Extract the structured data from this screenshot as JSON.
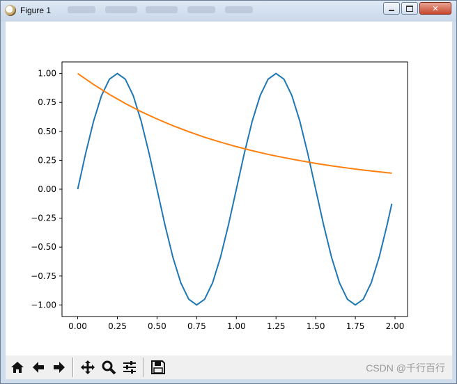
{
  "window": {
    "title": "Figure 1",
    "buttons": {
      "minimize": "minimize",
      "maximize": "maximize",
      "close": "close"
    }
  },
  "toolbar": {
    "items": [
      {
        "name": "home",
        "icon": "home-icon"
      },
      {
        "name": "back",
        "icon": "arrow-left-icon"
      },
      {
        "name": "forward",
        "icon": "arrow-right-icon"
      },
      {
        "name": "pan",
        "icon": "move-icon"
      },
      {
        "name": "zoom",
        "icon": "magnifier-icon"
      },
      {
        "name": "configure-subplots",
        "icon": "sliders-icon"
      },
      {
        "name": "save",
        "icon": "floppy-disk-icon"
      }
    ]
  },
  "watermark": "CSDN @千行百行",
  "chart_data": {
    "type": "line",
    "title": "",
    "xlabel": "",
    "ylabel": "",
    "xlim": [
      -0.099,
      2.079
    ],
    "ylim": [
      -1.1,
      1.1
    ],
    "grid": false,
    "x_ticks": [
      "0.00",
      "0.25",
      "0.50",
      "0.75",
      "1.00",
      "1.25",
      "1.50",
      "1.75",
      "2.00"
    ],
    "x_tick_values": [
      0,
      0.25,
      0.5,
      0.75,
      1.0,
      1.25,
      1.5,
      1.75,
      2.0
    ],
    "y_ticks": [
      "−1.00",
      "−0.75",
      "−0.50",
      "−0.25",
      "0.00",
      "0.25",
      "0.50",
      "0.75",
      "1.00"
    ],
    "y_tick_values": [
      -1,
      -0.75,
      -0.5,
      -0.25,
      0,
      0.25,
      0.5,
      0.75,
      1
    ],
    "series": [
      {
        "color": "#1f77b4",
        "x": [
          0.0,
          0.05,
          0.1,
          0.15,
          0.2,
          0.25,
          0.3,
          0.35,
          0.4,
          0.45,
          0.5,
          0.55,
          0.6,
          0.65,
          0.7,
          0.75,
          0.8,
          0.85,
          0.9,
          0.95,
          1.0,
          1.05,
          1.1,
          1.15,
          1.2,
          1.25,
          1.3,
          1.35,
          1.4,
          1.45,
          1.5,
          1.55,
          1.6,
          1.65,
          1.7,
          1.75,
          1.8,
          1.85,
          1.9,
          1.95,
          1.98
        ],
        "y": [
          0.0,
          0.309,
          0.588,
          0.809,
          0.951,
          1.0,
          0.951,
          0.809,
          0.588,
          0.309,
          0.0,
          -0.309,
          -0.588,
          -0.809,
          -0.951,
          -1.0,
          -0.951,
          -0.809,
          -0.588,
          -0.309,
          0.0,
          0.309,
          0.588,
          0.809,
          0.951,
          1.0,
          0.951,
          0.809,
          0.588,
          0.309,
          0.0,
          -0.309,
          -0.588,
          -0.809,
          -0.951,
          -1.0,
          -0.951,
          -0.809,
          -0.588,
          -0.309,
          -0.125
        ]
      },
      {
        "color": "#ff7f0e",
        "x": [
          0.0,
          0.1,
          0.2,
          0.3,
          0.4,
          0.5,
          0.6,
          0.7,
          0.8,
          0.9,
          1.0,
          1.1,
          1.2,
          1.3,
          1.4,
          1.5,
          1.6,
          1.7,
          1.8,
          1.9,
          1.98
        ],
        "y": [
          1.0,
          0.905,
          0.819,
          0.741,
          0.67,
          0.607,
          0.549,
          0.497,
          0.449,
          0.407,
          0.368,
          0.333,
          0.301,
          0.273,
          0.247,
          0.223,
          0.202,
          0.183,
          0.165,
          0.15,
          0.138
        ]
      }
    ]
  }
}
